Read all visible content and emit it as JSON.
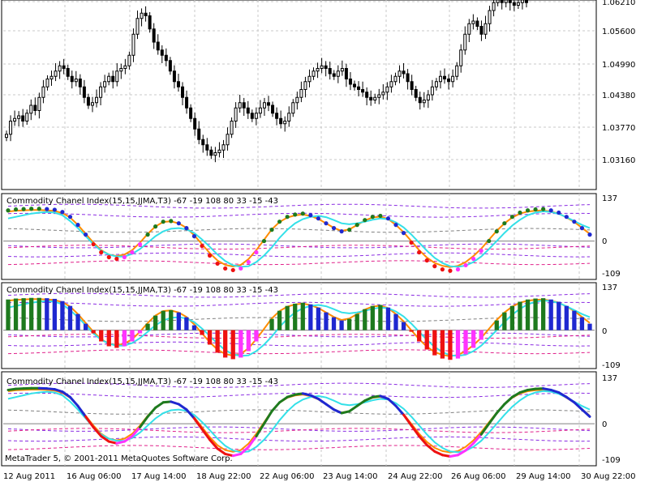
{
  "app": "MetaTrader 5",
  "copyright": "MetaTrader 5, © 2001-2011 MetaQuotes Software Corp.",
  "colors": {
    "background": "#ffffff",
    "grid": "#c8c8c8",
    "candle": "#000000",
    "up_green": "#1e7a1e",
    "down_blue": "#1f28d0",
    "down_red": "#ee1111",
    "up_magenta": "#ff33ff",
    "fast_line_orange": "#ff8c00",
    "slow_line_cyan": "#33e0e8",
    "level_magenta": "#e0208a",
    "level_violet": "#8a2be2",
    "level_gray": "#808080"
  },
  "chart_data": [
    {
      "type": "candlestick",
      "title": "",
      "y_ticks": [
        "1.06210",
        "1.05600",
        "1.04990",
        "1.04380",
        "1.03770",
        "1.03160"
      ],
      "ylim": [
        1.0265,
        1.0625
      ],
      "x_labels": [
        "12 Aug 2011",
        "16 Aug 06:00",
        "17 Aug 14:00",
        "18 Aug 22:00",
        "22 Aug 06:00",
        "23 Aug 14:00",
        "24 Aug 22:00",
        "26 Aug 06:00",
        "29 Aug 14:00",
        "30 Aug 22:00"
      ],
      "close": [
        1.037,
        1.0395,
        1.04,
        1.0405,
        1.0395,
        1.041,
        1.0425,
        1.0415,
        1.044,
        1.046,
        1.0475,
        1.048,
        1.049,
        1.05,
        1.0495,
        1.048,
        1.047,
        1.0475,
        1.046,
        1.044,
        1.0425,
        1.043,
        1.044,
        1.046,
        1.047,
        1.048,
        1.047,
        1.049,
        1.0495,
        1.05,
        1.052,
        1.056,
        1.059,
        1.06,
        1.0595,
        1.057,
        1.0545,
        1.053,
        1.052,
        1.051,
        1.049,
        1.047,
        1.046,
        1.044,
        1.042,
        1.04,
        1.038,
        1.036,
        1.035,
        1.034,
        1.033,
        1.0335,
        1.034,
        1.035,
        1.037,
        1.0395,
        1.042,
        1.043,
        1.042,
        1.041,
        1.04,
        1.041,
        1.042,
        1.043,
        1.0425,
        1.041,
        1.04,
        1.039,
        1.0395,
        1.041,
        1.043,
        1.044,
        1.0455,
        1.047,
        1.048,
        1.049,
        1.0495,
        1.05,
        1.0495,
        1.0485,
        1.048,
        1.049,
        1.0495,
        1.0475,
        1.0465,
        1.046,
        1.0455,
        1.045,
        1.044,
        1.0435,
        1.044,
        1.0445,
        1.045,
        1.046,
        1.047,
        1.048,
        1.049,
        1.0485,
        1.047,
        1.0455,
        1.044,
        1.043,
        1.0435,
        1.0445,
        1.046,
        1.047,
        1.048,
        1.0475,
        1.047,
        1.048,
        1.05,
        1.053,
        1.056,
        1.058,
        1.0585,
        1.0575,
        1.056,
        1.058,
        1.0605,
        1.062,
        1.0625,
        1.062,
        1.0625,
        1.062,
        1.0615,
        1.062,
        1.0625,
        1.062
      ],
      "candle_body_range": 0.0012
    },
    {
      "type": "line",
      "title": "Commodity Chanel Index(15,15,JJMA,T3) -67 -19 108 80 33 -15 -43",
      "style": "dots",
      "y_ticks": [
        "137",
        "0",
        "-109"
      ],
      "ylim": [
        -109,
        137
      ],
      "levels": [
        108,
        80,
        33,
        -15,
        -43,
        -67,
        -19
      ]
    },
    {
      "type": "bar",
      "title": "Commodity Chanel Index(15,15,JJMA,T3) -67 -19 108 80 33 -15 -43",
      "style": "histogram",
      "y_ticks": [
        "137",
        "0",
        "-109"
      ],
      "ylim": [
        -109,
        137
      ],
      "levels": [
        108,
        80,
        33,
        -15,
        -43,
        -67,
        -19
      ]
    },
    {
      "type": "line",
      "title": "Commodity Chanel Index(15,15,JJMA,T3) -67 -19 108 80 33 -15 -43",
      "style": "colored line",
      "y_ticks": [
        "137",
        "0",
        "-109"
      ],
      "ylim": [
        -109,
        137
      ],
      "levels": [
        108,
        80,
        33,
        -15,
        -43,
        -67,
        -19
      ]
    }
  ],
  "cci": {
    "fast": [
      95,
      98,
      99,
      100,
      100,
      99,
      97,
      90,
      75,
      50,
      20,
      -10,
      -35,
      -50,
      -55,
      -50,
      -35,
      -10,
      20,
      45,
      60,
      62,
      55,
      40,
      15,
      -15,
      -45,
      -70,
      -85,
      -90,
      -85,
      -65,
      -35,
      0,
      35,
      60,
      75,
      82,
      85,
      80,
      70,
      55,
      40,
      30,
      35,
      50,
      65,
      75,
      78,
      70,
      50,
      25,
      -5,
      -35,
      -60,
      -78,
      -88,
      -92,
      -88,
      -75,
      -55,
      -30,
      0,
      30,
      55,
      75,
      88,
      95,
      98,
      99,
      95,
      88,
      75,
      60,
      40,
      20
    ],
    "slow": [
      70,
      75,
      80,
      85,
      88,
      90,
      88,
      80,
      62,
      40,
      15,
      -10,
      -30,
      -42,
      -48,
      -48,
      -40,
      -25,
      -5,
      15,
      30,
      38,
      40,
      36,
      25,
      5,
      -18,
      -42,
      -62,
      -75,
      -80,
      -78,
      -65,
      -45,
      -20,
      10,
      35,
      55,
      68,
      75,
      78,
      74,
      65,
      55,
      52,
      55,
      60,
      66,
      70,
      68,
      58,
      42,
      20,
      -5,
      -30,
      -52,
      -68,
      -78,
      -80,
      -76,
      -65,
      -48,
      -25,
      0,
      25,
      48,
      66,
      80,
      88,
      92,
      90,
      84,
      74,
      62,
      50,
      40
    ]
  }
}
